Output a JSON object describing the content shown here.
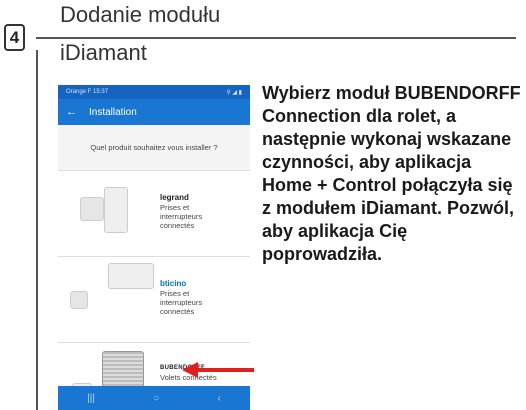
{
  "step": {
    "number": "4",
    "title_line1": "Dodanie modułu",
    "title_line2": "iDiamant"
  },
  "phone": {
    "status": {
      "carrier_time": "Orange F 15:37",
      "indicators": "⚲ ◢ ▮"
    },
    "app_bar": {
      "back_icon": "←",
      "title": "Installation"
    },
    "question": "Quel produit souhaitez vous installer ?",
    "products": [
      {
        "brand": "legrand",
        "description": "Prises et\ninterrupteurs\nconnectés"
      },
      {
        "brand": "bticino",
        "description": "Prises et\ninterrupteurs\nconnectés"
      },
      {
        "brand": "BUBENDORFF",
        "description": "Volets connectés"
      }
    ],
    "nav": {
      "recent": "|||",
      "home": "○",
      "back": "‹"
    }
  },
  "instructions": "Wybierz moduł BUBENDORFF Connection dla rolet, a następnie wykonaj wskazane czynności, aby aplikacja Home + Control połączyła się z modułem iDiamant. Pozwól, aby aplikacja Cię poprowadziła.",
  "colors": {
    "app_blue": "#1976d2",
    "arrow_red": "#e02020"
  }
}
